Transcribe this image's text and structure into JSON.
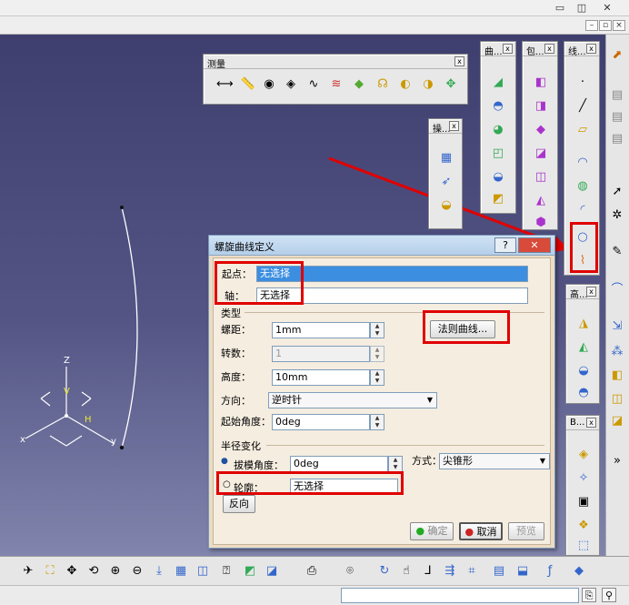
{
  "toolbars": {
    "measure": {
      "title": "测量"
    },
    "t_surface": {
      "title": "曲..."
    },
    "t_wrap": {
      "title": "包..."
    },
    "t_line": {
      "title": "线..."
    },
    "t_ops": {
      "title": "操..."
    },
    "t_high": {
      "title": "高..."
    },
    "t_b": {
      "title": "B..."
    }
  },
  "axis": {
    "z": "Z",
    "v": "V",
    "h": "H",
    "x": "x",
    "y": "y"
  },
  "dialog": {
    "title": "螺旋曲线定义",
    "help": "?",
    "start_label": "起点：",
    "start_value": "无选择",
    "axis_label": "轴：",
    "axis_value": "无选择",
    "type_section": "类型",
    "pitch_label": "螺距：",
    "pitch_value": "1mm",
    "law_button": "法则曲线...",
    "turns_label": "转数：",
    "turns_value": "1",
    "height_label": "高度：",
    "height_value": "10mm",
    "direction_label": "方向：",
    "direction_value": "逆时针",
    "start_angle_label": "起始角度：",
    "start_angle_value": "0deg",
    "radius_section": "半径变化",
    "draft_label": "拔模角度：",
    "draft_value": "0deg",
    "mode_label": "方式：",
    "mode_value": "尖锥形",
    "profile_label": "轮廓：",
    "profile_value": "无选择",
    "reverse_button": "反向",
    "ok_button": "确定",
    "cancel_button": "取消",
    "preview_button": "预览"
  },
  "colors": {
    "highlight": "#e00000",
    "arrow": "#e00000",
    "selection": "#3b8ee0"
  }
}
